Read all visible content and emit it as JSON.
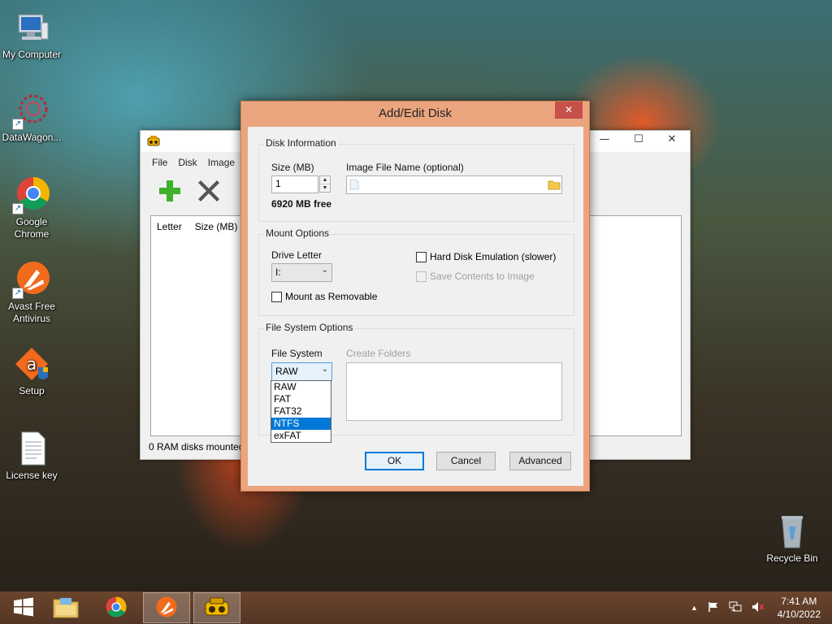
{
  "desktop": {
    "icons": [
      {
        "label": "My Computer"
      },
      {
        "label": "DataWagon..."
      },
      {
        "label": "Google Chrome"
      },
      {
        "label": "Avast Free Antivirus"
      },
      {
        "label": "Setup"
      },
      {
        "label": "License key"
      },
      {
        "label": "Recycle Bin"
      }
    ]
  },
  "app_window": {
    "menu": [
      "File",
      "Disk",
      "Image"
    ],
    "columns": [
      "Letter",
      "Size (MB)"
    ],
    "status": "0 RAM disks mounted"
  },
  "dialog": {
    "title": "Add/Edit Disk",
    "disk_info": {
      "group_title": "Disk Information",
      "size_label": "Size (MB)",
      "size_value": "1",
      "free_text": "6920 MB free",
      "image_label": "Image File Name (optional)",
      "image_value": ""
    },
    "mount": {
      "group_title": "Mount Options",
      "drive_letter_label": "Drive Letter",
      "drive_letter_value": "I:",
      "removable_label": "Mount as Removable",
      "hard_disk_label": "Hard Disk Emulation (slower)",
      "save_contents_label": "Save Contents to Image"
    },
    "fs": {
      "group_title": "File System Options",
      "fs_label": "File System",
      "fs_value": "RAW",
      "create_folders_label": "Create Folders",
      "options": [
        "RAW",
        "FAT",
        "FAT32",
        "NTFS",
        "exFAT"
      ],
      "highlighted": "NTFS"
    },
    "buttons": {
      "ok": "OK",
      "cancel": "Cancel",
      "advanced": "Advanced"
    }
  },
  "taskbar": {
    "time": "7:41 AM",
    "date": "4/10/2022"
  }
}
